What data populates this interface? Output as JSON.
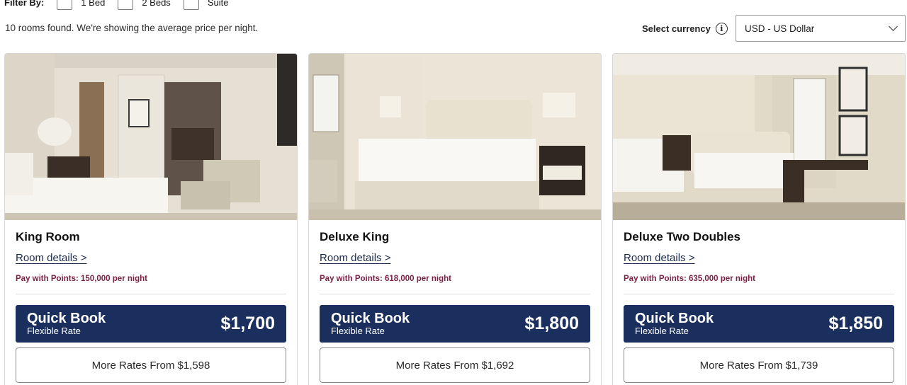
{
  "filter": {
    "label": "Filter By:",
    "options": [
      {
        "label": "1 Bed"
      },
      {
        "label": "2 Beds"
      },
      {
        "label": "Suite"
      }
    ]
  },
  "summary": "10 rooms found. We're showing the average price per night.",
  "currency": {
    "label": "Select currency",
    "info_glyph": "i",
    "selected": "USD - US Dollar"
  },
  "rooms": [
    {
      "name": "King Room",
      "details_label": "Room details >",
      "points": "Pay with Points: 150,000 per night",
      "quick_book": {
        "title": "Quick Book",
        "subtitle": "Flexible Rate",
        "price": "$1,700"
      },
      "more_rates": "More Rates From $1,598"
    },
    {
      "name": "Deluxe King",
      "details_label": "Room details >",
      "points": "Pay with Points: 618,000 per night",
      "quick_book": {
        "title": "Quick Book",
        "subtitle": "Flexible Rate",
        "price": "$1,800"
      },
      "more_rates": "More Rates From $1,692"
    },
    {
      "name": "Deluxe Two Doubles",
      "details_label": "Room details >",
      "points": "Pay with Points: 635,000 per night",
      "quick_book": {
        "title": "Quick Book",
        "subtitle": "Flexible Rate",
        "price": "$1,850"
      },
      "more_rates": "More Rates From $1,739"
    }
  ],
  "colors": {
    "quick_book_bg": "#1b2f5f",
    "points_text": "#7a2145",
    "link_text": "#1b2a4a"
  }
}
